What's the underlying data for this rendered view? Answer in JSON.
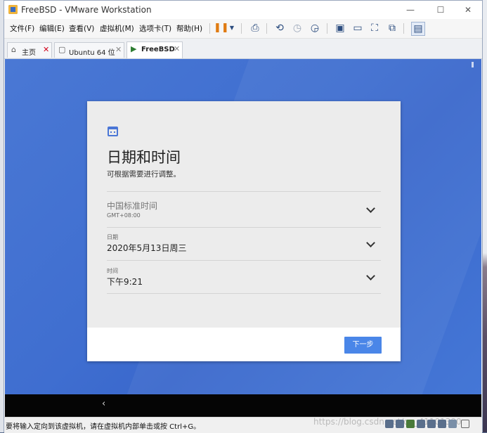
{
  "window": {
    "title": "FreeBSD - VMware Workstation",
    "controls": {
      "minimize": "—",
      "maximize": "☐",
      "close": "✕"
    }
  },
  "menu": {
    "items": [
      "文件(F)",
      "编辑(E)",
      "查看(V)",
      "虚拟机(M)",
      "选项卡(T)",
      "帮助(H)"
    ]
  },
  "toolbar": {
    "icons": [
      "pause-icon",
      "dropdown-icon",
      "send-ctrl-alt-del-icon",
      "snapshot-icon",
      "revert-snapshot-icon",
      "snapshot-manager-icon",
      "sidebar-view-icon",
      "console-view-icon",
      "fullscreen-icon",
      "unity-icon",
      "thumbnail-icon"
    ]
  },
  "tabs": [
    {
      "label": "主页",
      "close": "✕",
      "close_color": "#d0021b"
    },
    {
      "label": "Ubuntu 64 位",
      "close": "✕"
    },
    {
      "label": "FreeBSD",
      "close": "✕",
      "active": true
    }
  ],
  "dialog": {
    "heading": "日期和时间",
    "subtitle": "可根据需要进行调整。",
    "timezone": {
      "value": "中国标准时间",
      "offset": "GMT+08:00"
    },
    "date": {
      "label": "日期",
      "value": "2020年5月13日周三"
    },
    "time": {
      "label": "时间",
      "value": "下午9:21"
    },
    "next_button": "下一步"
  },
  "guest": {
    "back_icon": "‹"
  },
  "status": {
    "message": "要将输入定向到该虚拟机，请在虚拟机内部单击或按 Ctrl+G。",
    "watermark": "https://blog.csdn.net/qq_41101390"
  },
  "colors": {
    "guest_background": "#4072d2",
    "accent": "#4a86e8",
    "tab_home_close": "#d0021b"
  }
}
